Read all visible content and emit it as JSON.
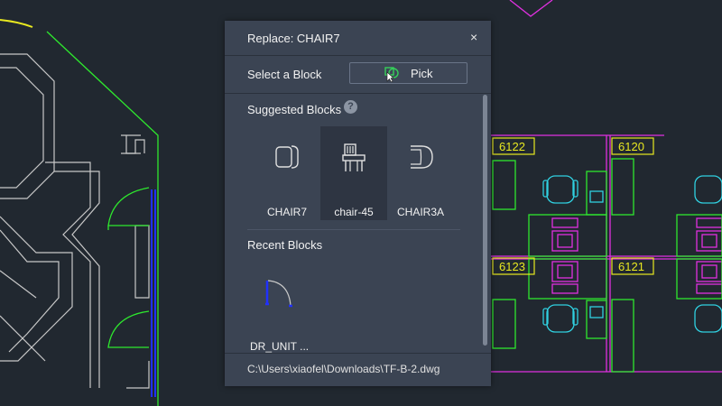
{
  "dialog": {
    "title": "Replace: CHAIR7",
    "close_glyph": "×",
    "select_label": "Select a Block",
    "pick_label": "Pick",
    "pick_icon": "pick-cursor-icon",
    "suggested_heading": "Suggested Blocks",
    "help_glyph": "?",
    "suggested": [
      {
        "label": "CHAIR7",
        "icon": "chair7-block-icon",
        "selected": false
      },
      {
        "label": "chair-45",
        "icon": "chair-45-block-icon",
        "selected": true
      },
      {
        "label": "CHAIR3A",
        "icon": "chair3a-block-icon",
        "selected": false
      }
    ],
    "recent_heading": "Recent Blocks",
    "recent": [
      {
        "label": "DR_UNIT ...",
        "icon": "door-unit-block-icon"
      }
    ],
    "file_path": "C:\\Users\\xiaofel\\Downloads\\TF-B-2.dwg"
  },
  "drawing": {
    "rooms": [
      "6122",
      "6120",
      "6123",
      "6121"
    ]
  },
  "colors": {
    "background": "#212830",
    "panel": "#3b4453",
    "green": "#2ee82e",
    "magenta": "#e030e0",
    "cyan": "#30d0e0",
    "yellow": "#e8e820",
    "blue": "#2030ff",
    "white_line": "#c8c8c8"
  }
}
